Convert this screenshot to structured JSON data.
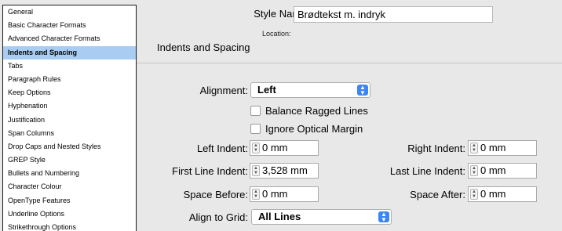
{
  "categories": [
    {
      "label": "General"
    },
    {
      "label": "Basic Character Formats"
    },
    {
      "label": "Advanced Character Formats"
    },
    {
      "label": "Indents and Spacing",
      "selected": true
    },
    {
      "label": "Tabs"
    },
    {
      "label": "Paragraph Rules"
    },
    {
      "label": "Keep Options"
    },
    {
      "label": "Hyphenation"
    },
    {
      "label": "Justification"
    },
    {
      "label": "Span Columns"
    },
    {
      "label": "Drop Caps and Nested Styles"
    },
    {
      "label": "GREP Style"
    },
    {
      "label": "Bullets and Numbering"
    },
    {
      "label": "Character Colour"
    },
    {
      "label": "OpenType Features"
    },
    {
      "label": "Underline Options"
    },
    {
      "label": "Strikethrough Options"
    }
  ],
  "style_name": {
    "label": "Style Name:",
    "value": "Brødtekst m. indryk"
  },
  "location": {
    "label": "Location:"
  },
  "section_title": "Indents and Spacing",
  "alignment": {
    "label": "Alignment:",
    "value": "Left"
  },
  "balance_ragged": {
    "label": "Balance Ragged Lines",
    "checked": false
  },
  "ignore_optical": {
    "label": "Ignore Optical Margin",
    "checked": false
  },
  "left_indent": {
    "label": "Left Indent:",
    "value": "0 mm"
  },
  "right_indent": {
    "label": "Right Indent:",
    "value": "0 mm"
  },
  "first_line_indent": {
    "label": "First Line Indent:",
    "value": "3,528 mm"
  },
  "last_line_indent": {
    "label": "Last Line Indent:",
    "value": "0 mm"
  },
  "space_before": {
    "label": "Space Before:",
    "value": "0 mm"
  },
  "space_after": {
    "label": "Space After:",
    "value": "0 mm"
  },
  "align_to_grid": {
    "label": "Align to Grid:",
    "value": "All Lines"
  },
  "colors": {
    "selection": "#a9cdf2",
    "accent": "#3b86f2"
  }
}
